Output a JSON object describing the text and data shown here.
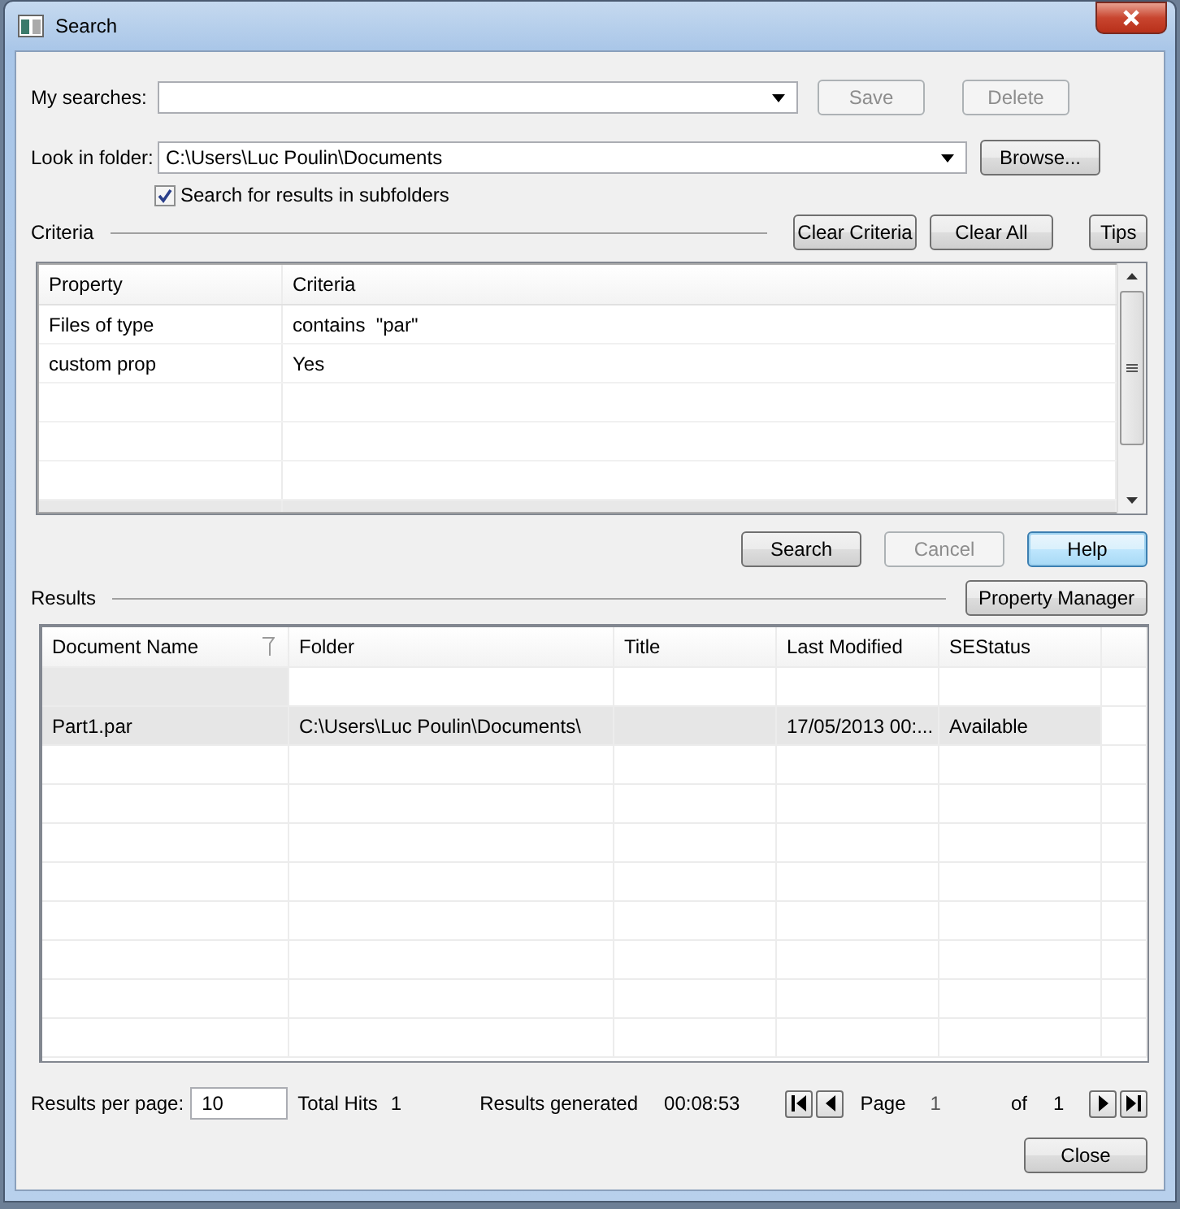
{
  "window": {
    "title": "Search"
  },
  "my_searches": {
    "label": "My searches:"
  },
  "search_buttons": [
    {
      "label": "Save",
      "disabled": true
    },
    {
      "label": "Delete",
      "disabled": true
    }
  ],
  "look_in": {
    "label": "Look in folder:",
    "value": "C:\\Users\\Luc Poulin\\Documents",
    "button": "Browse..."
  },
  "subfolders": {
    "label": "Search for results in subfolders",
    "checked": true
  },
  "criteria": {
    "title": "Criteria",
    "buttons": [
      "Clear Criteria",
      "Clear All",
      "Tips"
    ],
    "columns": [
      "Property",
      "Criteria"
    ],
    "rows": [
      [
        "Files of type",
        "contains  \"par\""
      ],
      [
        "custom prop",
        "Yes"
      ]
    ]
  },
  "actions": [
    {
      "label": "Search",
      "disabled": false,
      "focused": false
    },
    {
      "label": "Cancel",
      "disabled": true,
      "focused": false
    },
    {
      "label": "Help",
      "disabled": false,
      "focused": true
    }
  ],
  "results": {
    "title": "Results",
    "button": "Property Manager",
    "columns": [
      "Document Name",
      "Folder",
      "Title",
      "Last Modified",
      "SEStatus"
    ],
    "rows": [
      {
        "cells": [
          "Part1.par",
          "C:\\Users\\Luc Poulin\\Documents\\",
          "",
          "17/05/2013 00:...",
          "Available"
        ],
        "selected": true
      }
    ]
  },
  "footer": {
    "per_page_label": "Results per page:",
    "per_page": "10",
    "hits_label": "Total Hits",
    "hits": "1",
    "generated_label": "Results generated",
    "generated": "00:08:53",
    "page_label": "Page",
    "page": "1",
    "of_label": "of",
    "pages": "1"
  },
  "close_button": "Close"
}
